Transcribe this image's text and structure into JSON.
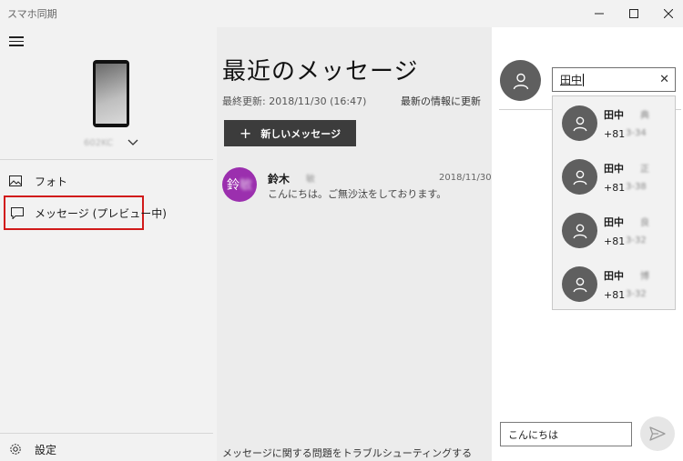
{
  "window": {
    "title": "スマホ同期"
  },
  "sidebar": {
    "device_name": "602KC",
    "items": [
      {
        "label": "フォト",
        "icon": "photo-icon"
      },
      {
        "label": "メッセージ (プレビュー中)",
        "icon": "message-icon",
        "selected": true
      }
    ],
    "settings_label": "設定"
  },
  "messages": {
    "title": "最近のメッセージ",
    "last_updated": "最終更新: 2018/11/30 (16:47)",
    "refresh_label": "最新の情報に更新",
    "new_message_label": "新しいメッセージ",
    "conversations": [
      {
        "avatar_text": "鈴",
        "avatar_text_blurred": "敏",
        "name": "鈴木",
        "name_blurred": "敏",
        "date": "2018/11/30",
        "preview": "こんにちは。ご無沙汰をしております。",
        "avatar_color": "#9b2fae"
      }
    ],
    "troubleshoot_label": "メッセージに関する問題をトラブルシューティングする"
  },
  "compose_panel": {
    "recipient_value": "田中",
    "suggestions": [
      {
        "name": "田中",
        "name_blurred": "典",
        "phone_prefix": "+81",
        "phone_blurred": "3-34"
      },
      {
        "name": "田中",
        "name_blurred": "正",
        "phone_prefix": "+81",
        "phone_blurred": "3-38"
      },
      {
        "name": "田中",
        "name_blurred": "良",
        "phone_prefix": "+81",
        "phone_blurred": "3-32"
      },
      {
        "name": "田中",
        "name_blurred": "博",
        "phone_prefix": "+81",
        "phone_blurred": "3-32"
      }
    ],
    "compose_value": "こんにちは"
  },
  "colors": {
    "accent_highlight": "#d11a1a",
    "avatar_purple": "#9b2fae",
    "avatar_gray": "#5f5f5f"
  }
}
